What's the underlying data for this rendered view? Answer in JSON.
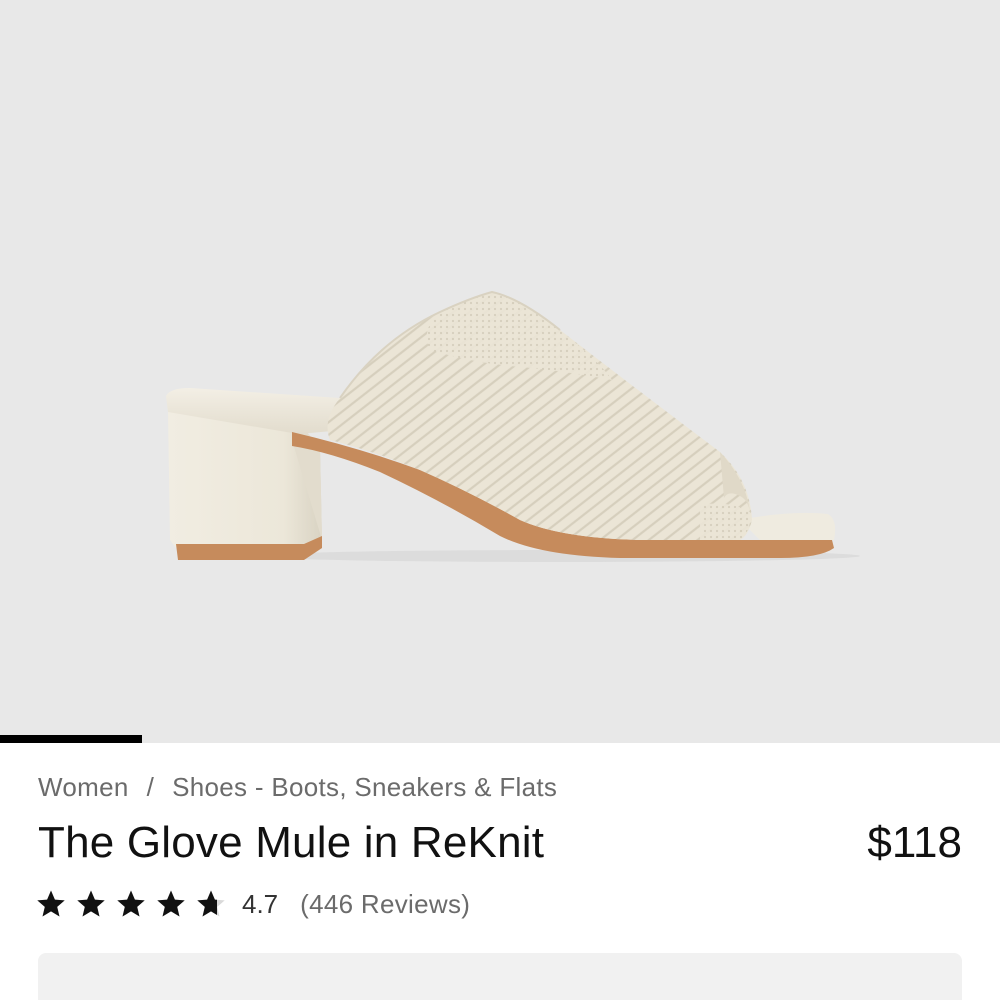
{
  "product_image": {
    "alt": "The Glove Mule in ReKnit"
  },
  "gallery": {
    "progress": 0.142
  },
  "breadcrumb": {
    "items": [
      "Women",
      "Shoes - Boots, Sneakers & Flats"
    ],
    "separator": "/"
  },
  "product": {
    "title": "The Glove Mule in ReKnit",
    "price": "$118"
  },
  "rating": {
    "stars": 4.7,
    "value_label": "4.7",
    "reviews_label": "(446 Reviews)"
  },
  "colors": {
    "hero_background": "#e8e8e8",
    "knit": "#ebe5d6",
    "sole": "#c68b5c",
    "heel": "#ece7d9",
    "accent_bar": "#000000"
  }
}
